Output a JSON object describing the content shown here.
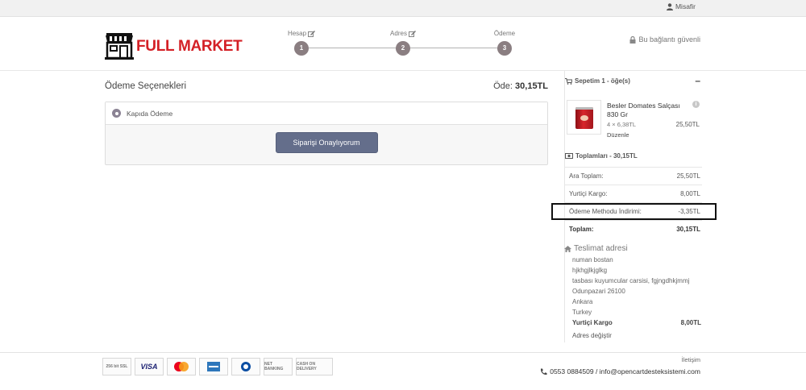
{
  "topbar": {
    "user_label": "Misafir"
  },
  "header": {
    "logo_text": "FULL MARKET",
    "steps": [
      {
        "label": "Hesap",
        "num": "1"
      },
      {
        "label": "Adres",
        "num": "2"
      },
      {
        "label": "Ödeme",
        "num": "3"
      }
    ],
    "secure_label": "Bu bağlantı güvenli"
  },
  "main": {
    "title": "Ödeme Seçenekleri",
    "total_prefix": "Öde:",
    "total_value": "30,15TL",
    "payment_option": "Kapıda Ödeme",
    "confirm_button": "Siparişi Onaylıyorum"
  },
  "cart": {
    "header": "Sepetim 1 - öğe(s)",
    "collapse_symbol": "–",
    "product": {
      "name": "Besler Domates Salçası 830 Gr",
      "qty": "4 × 6,38TL",
      "price": "25,50TL",
      "edit": "Düzenle"
    },
    "totals_header": "Toplamları - 30,15TL",
    "rows": [
      {
        "label": "Ara Toplam:",
        "value": "25,50TL"
      },
      {
        "label": "Yurtiçi Kargo:",
        "value": "8,00TL"
      },
      {
        "label": "Ödeme Methodu İndirimi:",
        "value": "-3,35TL"
      },
      {
        "label": "Toplam:",
        "value": "30,15TL"
      }
    ]
  },
  "address": {
    "title": "Teslimat adresi",
    "lines": [
      "numan bostan",
      "hjkhgjlkjglkg",
      "tasbası kuyumcular carsisi, fgjngdhkjmmj",
      "Odunpazari 26100",
      "Ankara",
      "Turkey"
    ],
    "shipping_label": "Yurtiçi Kargo",
    "shipping_value": "8,00TL",
    "change_link": "Adres değiştir"
  },
  "footer": {
    "badges": [
      "256 bit SSL",
      "VISA",
      "MasterCard",
      "AMEX",
      "Diners Club",
      "NET BANKING",
      "CASH ON DELIVERY"
    ],
    "contact_title": "İletişim",
    "contact_text": "0553 0884509 / info@opencartdesteksistemi.com"
  },
  "colors": {
    "brand": "#d42026",
    "button": "#646e8b",
    "step": "#8a7e81"
  }
}
